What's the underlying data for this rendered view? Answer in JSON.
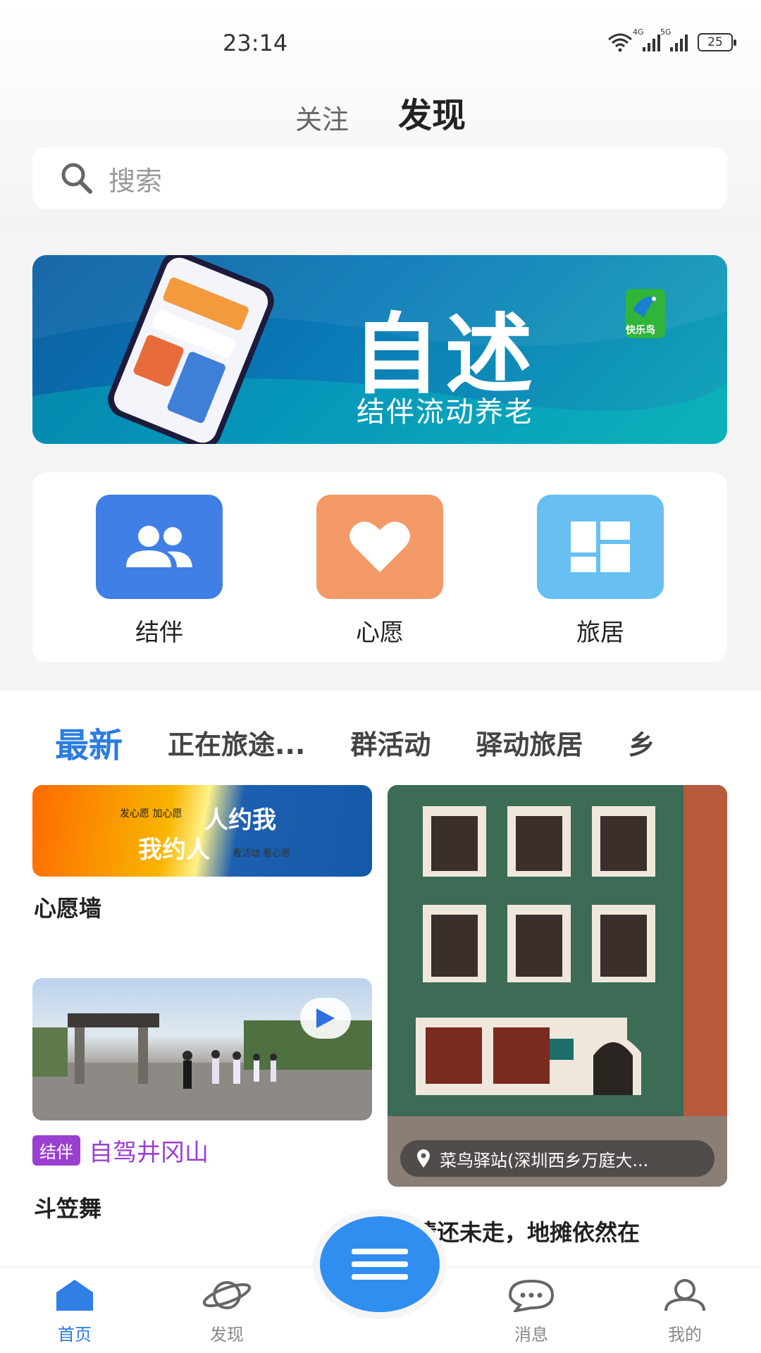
{
  "status_bar": {
    "time": "23:14",
    "battery": "25",
    "wifi_label": "6",
    "sig1_label": "4G",
    "sig2_label": "5G"
  },
  "header": {
    "tab_follow": "关注",
    "tab_discover": "发现"
  },
  "search": {
    "placeholder": "搜索"
  },
  "banner": {
    "title": "自述",
    "subtitle": "结伴流动养老",
    "brand": "快乐鸟"
  },
  "menu": [
    {
      "label": "结伴",
      "color": "#3f7fe6",
      "icon": "people-icon"
    },
    {
      "label": "心愿",
      "color": "#f39a67",
      "icon": "heart-icon"
    },
    {
      "label": "旅居",
      "color": "#67bff2",
      "icon": "grid-icon"
    }
  ],
  "categories": [
    "最新",
    "正在旅途...",
    "群活动",
    "驿动旅居",
    "乡"
  ],
  "feed": {
    "wish_card": {
      "small1": "发心愿 加心愿",
      "big1": "人约我",
      "big2": "我约人",
      "small2": "看活动 看心愿",
      "title": "心愿墙"
    },
    "video_card": {
      "tag": "结伴",
      "tag_text": "自驾井冈山",
      "title": "斗笠舞"
    },
    "right_card": {
      "location": "菜鸟驿站(深圳西乡万庭大...",
      "title": "热情还未走，地摊依然在"
    }
  },
  "nav": [
    {
      "label": "首页",
      "icon": "home-icon",
      "active": true
    },
    {
      "label": "发现",
      "icon": "planet-icon",
      "active": false
    },
    {
      "label": "消息",
      "icon": "chat-icon",
      "active": false
    },
    {
      "label": "我的",
      "icon": "user-icon",
      "active": false
    }
  ],
  "colors": {
    "accent": "#2b7de0",
    "fab": "#2f8ef0",
    "tag": "#9b3fd0"
  }
}
